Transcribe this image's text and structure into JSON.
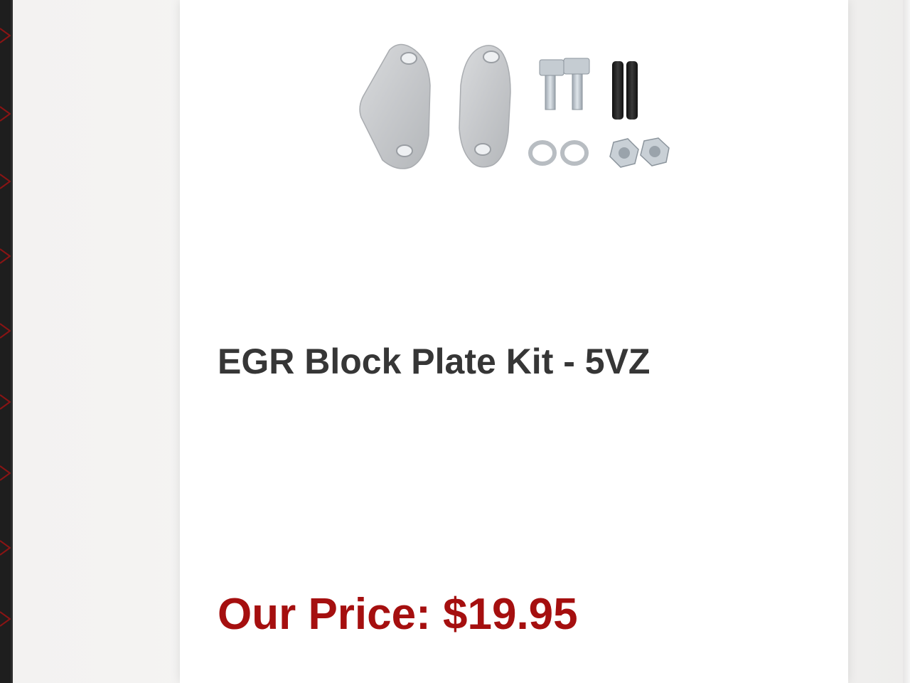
{
  "product": {
    "title": "EGR Block Plate Kit - 5VZ",
    "price_label": "Our Price:",
    "price_value": "$19.95",
    "image_icon": "egr-block-plate-kit-photo"
  },
  "colors": {
    "price": "#a50f0f",
    "title": "#363636",
    "card": "#ffffff",
    "background": "#f4f3f2",
    "left_edge": "#1d1d1d",
    "left_edge_pattern": "#8a1414"
  }
}
